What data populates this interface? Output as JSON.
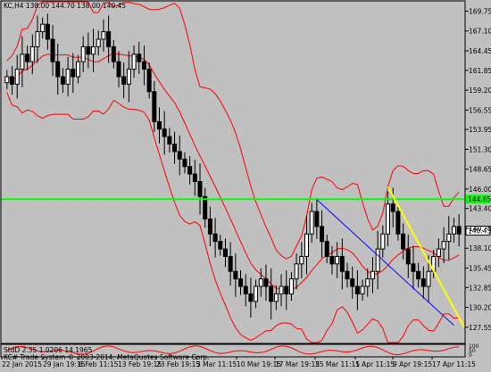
{
  "header": {
    "symbol_info": "KC,H4  138.00 144.70 138.00 140.45"
  },
  "chart_data": {
    "type": "candlestick",
    "title": "KC,H4  138.00 144.70 138.00 140.45",
    "colors": {
      "background": "#c0c0c0",
      "candle": "#000000",
      "bollinger": "#ff0000",
      "support_line": "#00ff00",
      "trend_blue": "#0000ff",
      "trend_yellow": "#ffff00",
      "oscillator": "#ff0000"
    },
    "y_ticks": [
      "169.75",
      "167.10",
      "164.45",
      "161.85",
      "159.20",
      "156.55",
      "153.95",
      "151.30",
      "148.65",
      "146.00",
      "143.40",
      "140.75",
      "138.10",
      "135.45",
      "132.85",
      "130.20",
      "127.55"
    ],
    "ylim": [
      125.5,
      171
    ],
    "x_ticks": [
      "22 Jan 2015",
      "29 Jan 19:15",
      "6 Feb 11:15",
      "13 Feb 19:15",
      "23 Feb 19:15",
      "3 Mar 11:15",
      "10 Mar 19:15",
      "17 Mar 19:15",
      "25 Mar 11:15",
      "1 Apr 11:15",
      "9 Apr 19:15",
      "17 Apr 11:15"
    ],
    "horizontal_line": {
      "value": 144.65,
      "label": "144.65"
    },
    "current_price": {
      "value": 140.45,
      "label": "140.45"
    },
    "trend_lines": [
      {
        "color": "blue",
        "from": {
          "bar": 61,
          "price": 144.6
        },
        "to": {
          "bar": 88,
          "price": 127.8
        }
      },
      {
        "color": "yellow",
        "from": {
          "bar": 75,
          "price": 146.3
        },
        "to": {
          "bar": 90,
          "price": 127.6
        }
      }
    ],
    "closes": [
      161,
      160,
      162,
      164,
      163,
      165,
      167,
      168,
      166,
      163,
      161,
      160,
      162,
      161,
      163,
      165,
      164,
      165,
      166,
      167,
      165,
      163,
      161,
      160,
      162,
      164,
      163,
      162,
      159,
      155,
      154,
      153,
      152,
      151,
      150,
      149,
      148,
      147,
      145,
      142,
      140,
      139,
      138,
      137,
      135,
      134,
      133,
      132,
      131,
      133,
      134,
      133,
      131,
      132,
      133,
      132,
      134,
      136,
      137,
      140,
      143,
      141,
      139,
      137,
      136,
      137,
      135,
      134,
      133,
      132,
      133,
      134,
      135,
      138,
      140,
      144,
      143,
      140,
      138,
      136,
      135,
      134,
      133,
      135,
      137,
      138,
      139,
      140,
      141,
      140
    ],
    "indicator": {
      "label": "StdD 2.35 1.0206 14.1965",
      "copyright": "KC# Trade System   © 2003-2014, MetaQuotes Software Corp.",
      "ticks": [
        "100",
        "50",
        "0"
      ]
    }
  }
}
